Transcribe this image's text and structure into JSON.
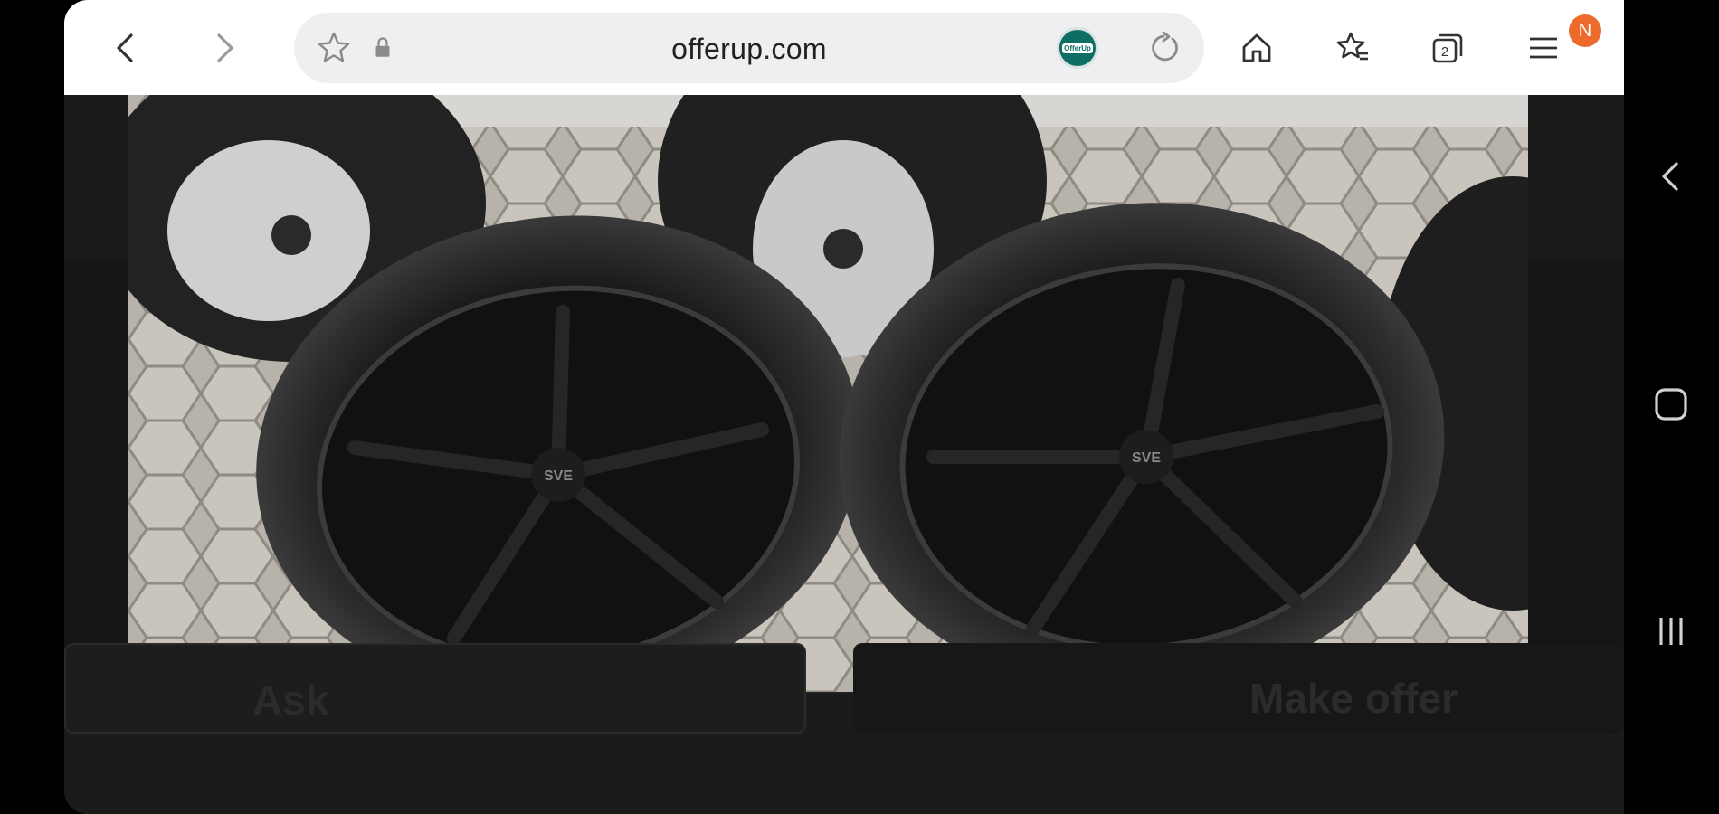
{
  "browser": {
    "url": "offerup.com",
    "tab_count": "2",
    "notification_initial": "N",
    "extension_label": "OfferUp"
  },
  "listing": {
    "photo_alt": "Two black multi-spoke alloy wheels with low-profile tires on brick pavers",
    "wheel_logo": "SVE"
  },
  "actions": {
    "ask_label": "Ask",
    "offer_label": "Make offer"
  },
  "icons": {
    "back": "chevron-left-icon",
    "forward": "chevron-right-icon",
    "bookmark": "star-icon",
    "secure": "lock-icon",
    "reload": "reload-icon",
    "home": "home-icon",
    "bookmarks": "star-list-icon",
    "tabs": "tabs-icon",
    "menu": "menu-icon"
  },
  "colors": {
    "toolbar_bg": "#ffffff",
    "url_bg": "#efeff1",
    "notif": "#ec6a2c",
    "ext": "#0f6e63",
    "page_bg": "#1a1a1a"
  }
}
